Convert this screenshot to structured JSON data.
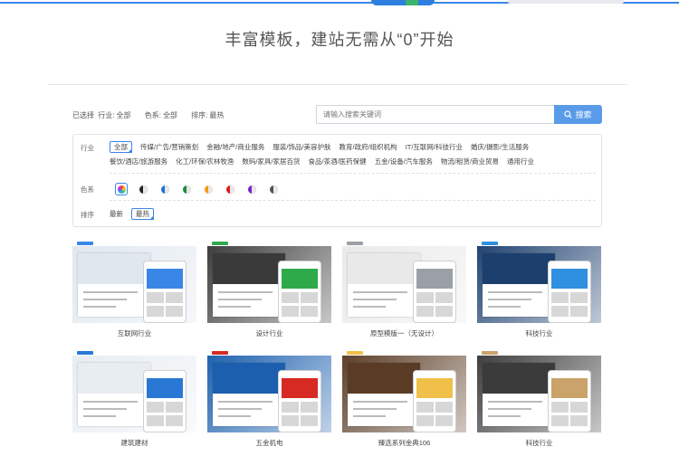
{
  "header": {
    "title": "丰富模板，建站无需从“0”开始"
  },
  "summary": {
    "prefix": "已选择",
    "industry_label": "行业:",
    "industry_value": "全部",
    "color_label": "色系:",
    "color_value": "全部",
    "sort_label": "排序:",
    "sort_value": "最热"
  },
  "search": {
    "placeholder": "请输入搜索关键词",
    "button_label": "搜索"
  },
  "filters": {
    "industry": {
      "label": "行业",
      "options": [
        "全部",
        "传媒/广告/营销策划",
        "金融/地产/商业服务",
        "服装/饰品/美容护肤",
        "教育/政府/组织机构",
        "IT/互联网/科技行业",
        "婚庆/摄影/生活服务",
        "餐饮/酒店/旅游服务",
        "化工/环保/农林牧渔",
        "数码/家具/家居百货",
        "食品/茶酒/医药保健",
        "五金/设备/汽车服务",
        "物流/租赁/商业贸易",
        "通用行业"
      ],
      "selected": "全部"
    },
    "color": {
      "label": "色系",
      "swatches": [
        {
          "name": "all-color",
          "color": "rainbow"
        },
        {
          "name": "black-color",
          "color": "#222222"
        },
        {
          "name": "blue-color",
          "color": "#1f6fd6"
        },
        {
          "name": "green-color",
          "color": "#1d8a3a"
        },
        {
          "name": "orange-color",
          "color": "#f59a14"
        },
        {
          "name": "red-color",
          "color": "#d81e1e"
        },
        {
          "name": "purple-color",
          "color": "#7a22c4"
        },
        {
          "name": "gray-color",
          "color": "#555555"
        }
      ]
    },
    "sort": {
      "label": "排序",
      "options": [
        "最新",
        "最热"
      ],
      "selected": "最热"
    }
  },
  "templates": [
    {
      "caption": "互联网行业",
      "theme": "#dfe7ef",
      "accent": "#3a86e6"
    },
    {
      "caption": "设计行业",
      "theme": "#3a3a3a",
      "accent": "#2eaa4b"
    },
    {
      "caption": "原型模版一（无设计）",
      "theme": "#e9e9e9",
      "accent": "#9aa0a6"
    },
    {
      "caption": "科技行业",
      "theme": "#1d3f6e",
      "accent": "#2f8fe0"
    },
    {
      "caption": "建筑建材",
      "theme": "#e8edf2",
      "accent": "#2a78d6"
    },
    {
      "caption": "五金机电",
      "theme": "#1b5fae",
      "accent": "#d62a22"
    },
    {
      "caption": "臻选系列金典106",
      "theme": "#5a3c26",
      "accent": "#f0c04a"
    },
    {
      "caption": "科技行业",
      "theme": "#3b3b3b",
      "accent": "#c9a36a"
    }
  ],
  "colors": {
    "accent": "#3a86e6",
    "search_button": "#5a9be9"
  }
}
